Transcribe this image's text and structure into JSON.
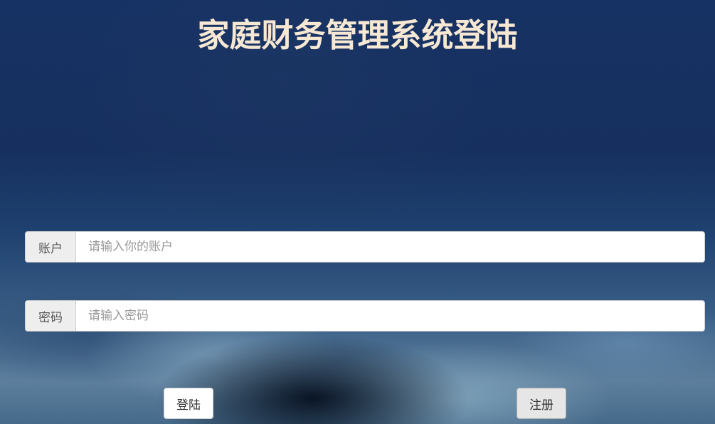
{
  "page": {
    "title": "家庭财务管理系统登陆"
  },
  "form": {
    "account": {
      "label": "账户",
      "placeholder": "请输入你的账户",
      "value": ""
    },
    "password": {
      "label": "密码",
      "placeholder": "请输入密码",
      "value": ""
    },
    "login_label": "登陆",
    "register_label": "注册"
  },
  "colors": {
    "title": "#f7e8d4",
    "background_top": "#163264",
    "addon_bg": "#eeeeee"
  }
}
